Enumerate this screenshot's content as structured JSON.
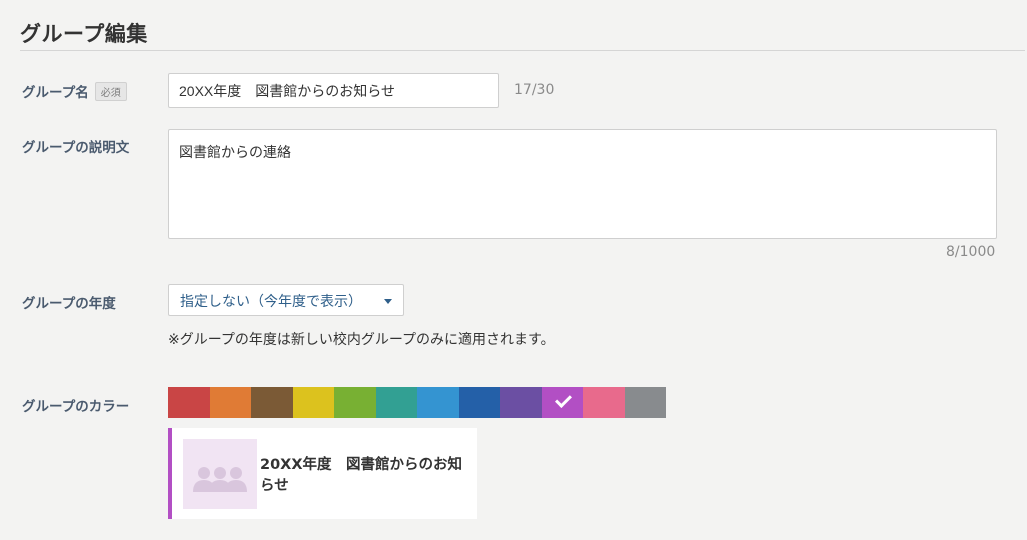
{
  "page": {
    "title": "グループ編集"
  },
  "group_name": {
    "label": "グループ名",
    "required_badge": "必須",
    "value": "20XX年度　図書館からのお知らせ",
    "counter": "17/30"
  },
  "description": {
    "label": "グループの説明文",
    "value": "図書館からの連絡",
    "counter": "8/1000"
  },
  "year": {
    "label": "グループの年度",
    "selected": "指定しない（今年度で表示）",
    "note": "※グループの年度は新しい校内グループのみに適用されます。"
  },
  "color": {
    "label": "グループのカラー",
    "swatches": [
      "#c94545",
      "#e07b35",
      "#7b5a36",
      "#dcc21e",
      "#78b033",
      "#32a093",
      "#3494d1",
      "#2460a8",
      "#6b4fa3",
      "#b24fc4",
      "#e86a8c",
      "#888b8e"
    ],
    "selected_index": 9
  },
  "preview": {
    "name": "20XX年度　図書館からのお知らせ",
    "accent": "#b24fc4"
  }
}
